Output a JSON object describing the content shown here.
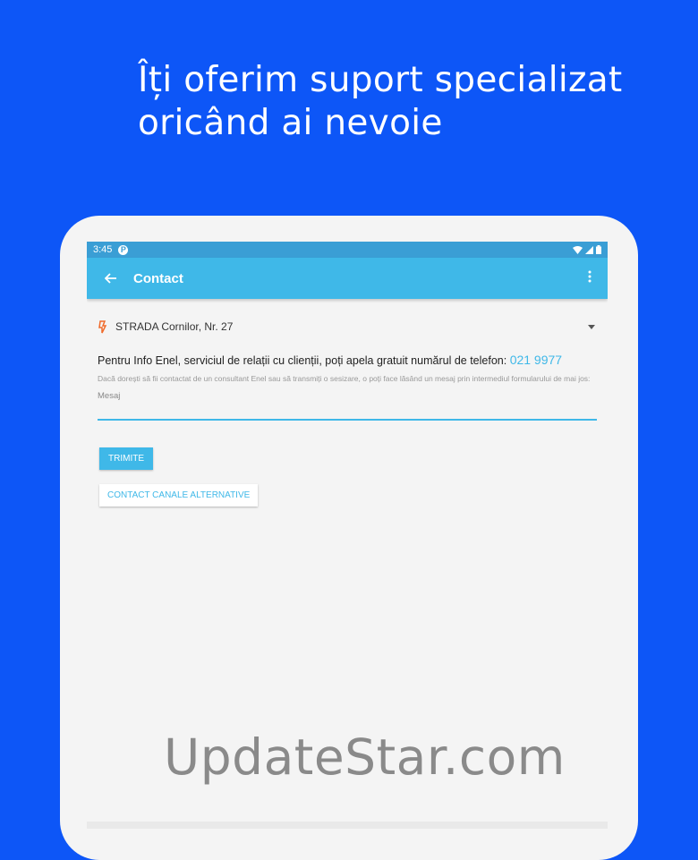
{
  "headline": {
    "line1": "Îți oferim suport specializat",
    "line2": "oricând ai nevoie"
  },
  "statusbar": {
    "time": "3:45",
    "notif_badge": "P",
    "icons": [
      "wifi-icon",
      "signal-icon",
      "battery-icon"
    ]
  },
  "appbar": {
    "back_icon": "arrow-back-icon",
    "title": "Contact",
    "menu_icon": "more-vert-icon",
    "color": "#3fb8e8"
  },
  "address": {
    "icon": "location-pin-icon",
    "value": "STRADA Cornilor, Nr. 27"
  },
  "info": {
    "text": "Pentru Info Enel, serviciul de relații cu clienții, poți apela gratuit numărul de telefon:",
    "phone": "021 9977",
    "hint": "Dacă dorești să fii contactat de un consultant Enel sau să transmiți o sesizare, o poți face lăsând un mesaj prin intermediul formularului de mai jos:"
  },
  "message": {
    "placeholder": "Mesaj",
    "value": ""
  },
  "buttons": {
    "send": "TRIMITE",
    "alternative": "CONTACT CANALE ALTERNATIVE"
  },
  "watermark": "UpdateStar.com",
  "colors": {
    "background": "#0d56f7",
    "accent": "#3fb8e8",
    "pin": "#f06a2a"
  }
}
